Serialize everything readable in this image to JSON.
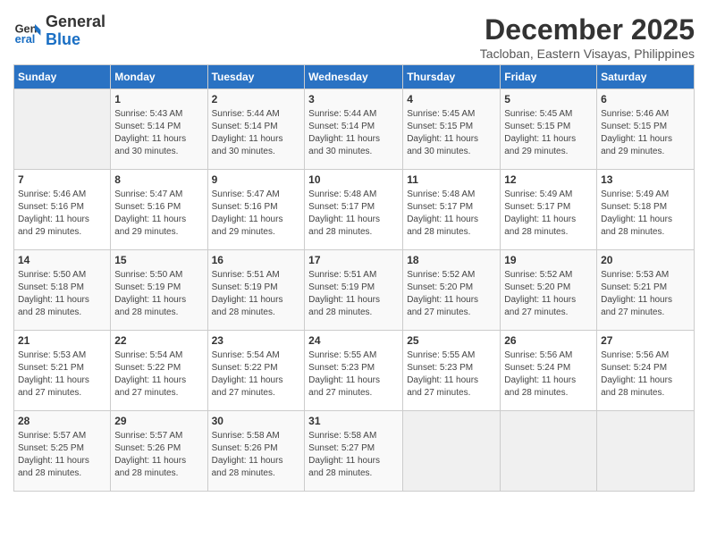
{
  "logo": {
    "line1": "General",
    "line2": "Blue"
  },
  "title": "December 2025",
  "subtitle": "Tacloban, Eastern Visayas, Philippines",
  "weekdays": [
    "Sunday",
    "Monday",
    "Tuesday",
    "Wednesday",
    "Thursday",
    "Friday",
    "Saturday"
  ],
  "weeks": [
    [
      {
        "day": "",
        "info": ""
      },
      {
        "day": "1",
        "info": "Sunrise: 5:43 AM\nSunset: 5:14 PM\nDaylight: 11 hours\nand 30 minutes."
      },
      {
        "day": "2",
        "info": "Sunrise: 5:44 AM\nSunset: 5:14 PM\nDaylight: 11 hours\nand 30 minutes."
      },
      {
        "day": "3",
        "info": "Sunrise: 5:44 AM\nSunset: 5:14 PM\nDaylight: 11 hours\nand 30 minutes."
      },
      {
        "day": "4",
        "info": "Sunrise: 5:45 AM\nSunset: 5:15 PM\nDaylight: 11 hours\nand 30 minutes."
      },
      {
        "day": "5",
        "info": "Sunrise: 5:45 AM\nSunset: 5:15 PM\nDaylight: 11 hours\nand 29 minutes."
      },
      {
        "day": "6",
        "info": "Sunrise: 5:46 AM\nSunset: 5:15 PM\nDaylight: 11 hours\nand 29 minutes."
      }
    ],
    [
      {
        "day": "7",
        "info": "Sunrise: 5:46 AM\nSunset: 5:16 PM\nDaylight: 11 hours\nand 29 minutes."
      },
      {
        "day": "8",
        "info": "Sunrise: 5:47 AM\nSunset: 5:16 PM\nDaylight: 11 hours\nand 29 minutes."
      },
      {
        "day": "9",
        "info": "Sunrise: 5:47 AM\nSunset: 5:16 PM\nDaylight: 11 hours\nand 29 minutes."
      },
      {
        "day": "10",
        "info": "Sunrise: 5:48 AM\nSunset: 5:17 PM\nDaylight: 11 hours\nand 28 minutes."
      },
      {
        "day": "11",
        "info": "Sunrise: 5:48 AM\nSunset: 5:17 PM\nDaylight: 11 hours\nand 28 minutes."
      },
      {
        "day": "12",
        "info": "Sunrise: 5:49 AM\nSunset: 5:17 PM\nDaylight: 11 hours\nand 28 minutes."
      },
      {
        "day": "13",
        "info": "Sunrise: 5:49 AM\nSunset: 5:18 PM\nDaylight: 11 hours\nand 28 minutes."
      }
    ],
    [
      {
        "day": "14",
        "info": "Sunrise: 5:50 AM\nSunset: 5:18 PM\nDaylight: 11 hours\nand 28 minutes."
      },
      {
        "day": "15",
        "info": "Sunrise: 5:50 AM\nSunset: 5:19 PM\nDaylight: 11 hours\nand 28 minutes."
      },
      {
        "day": "16",
        "info": "Sunrise: 5:51 AM\nSunset: 5:19 PM\nDaylight: 11 hours\nand 28 minutes."
      },
      {
        "day": "17",
        "info": "Sunrise: 5:51 AM\nSunset: 5:19 PM\nDaylight: 11 hours\nand 28 minutes."
      },
      {
        "day": "18",
        "info": "Sunrise: 5:52 AM\nSunset: 5:20 PM\nDaylight: 11 hours\nand 27 minutes."
      },
      {
        "day": "19",
        "info": "Sunrise: 5:52 AM\nSunset: 5:20 PM\nDaylight: 11 hours\nand 27 minutes."
      },
      {
        "day": "20",
        "info": "Sunrise: 5:53 AM\nSunset: 5:21 PM\nDaylight: 11 hours\nand 27 minutes."
      }
    ],
    [
      {
        "day": "21",
        "info": "Sunrise: 5:53 AM\nSunset: 5:21 PM\nDaylight: 11 hours\nand 27 minutes."
      },
      {
        "day": "22",
        "info": "Sunrise: 5:54 AM\nSunset: 5:22 PM\nDaylight: 11 hours\nand 27 minutes."
      },
      {
        "day": "23",
        "info": "Sunrise: 5:54 AM\nSunset: 5:22 PM\nDaylight: 11 hours\nand 27 minutes."
      },
      {
        "day": "24",
        "info": "Sunrise: 5:55 AM\nSunset: 5:23 PM\nDaylight: 11 hours\nand 27 minutes."
      },
      {
        "day": "25",
        "info": "Sunrise: 5:55 AM\nSunset: 5:23 PM\nDaylight: 11 hours\nand 27 minutes."
      },
      {
        "day": "26",
        "info": "Sunrise: 5:56 AM\nSunset: 5:24 PM\nDaylight: 11 hours\nand 28 minutes."
      },
      {
        "day": "27",
        "info": "Sunrise: 5:56 AM\nSunset: 5:24 PM\nDaylight: 11 hours\nand 28 minutes."
      }
    ],
    [
      {
        "day": "28",
        "info": "Sunrise: 5:57 AM\nSunset: 5:25 PM\nDaylight: 11 hours\nand 28 minutes."
      },
      {
        "day": "29",
        "info": "Sunrise: 5:57 AM\nSunset: 5:26 PM\nDaylight: 11 hours\nand 28 minutes."
      },
      {
        "day": "30",
        "info": "Sunrise: 5:58 AM\nSunset: 5:26 PM\nDaylight: 11 hours\nand 28 minutes."
      },
      {
        "day": "31",
        "info": "Sunrise: 5:58 AM\nSunset: 5:27 PM\nDaylight: 11 hours\nand 28 minutes."
      },
      {
        "day": "",
        "info": ""
      },
      {
        "day": "",
        "info": ""
      },
      {
        "day": "",
        "info": ""
      }
    ]
  ]
}
